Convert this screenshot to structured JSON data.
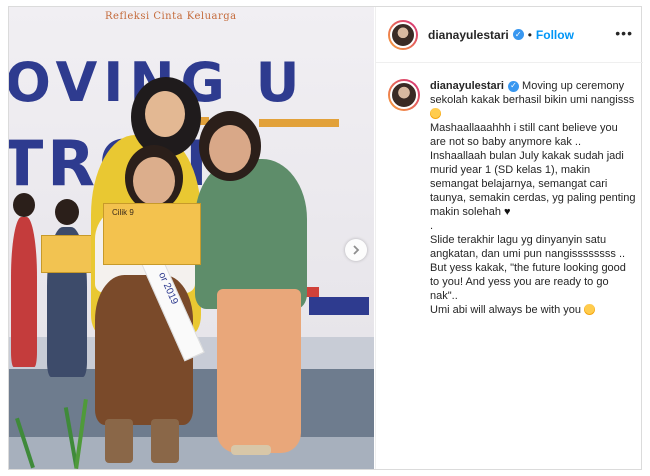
{
  "photo": {
    "banner_script": "Refleksi Cinta Keluarga",
    "banner_line1": "OVING U",
    "banner_line2": "TRON",
    "envelope_text": "Cilik 9",
    "sash_text": "or 2019",
    "next_icon": "chevron-right-icon"
  },
  "header": {
    "username": "dianayulestari",
    "separator": "•",
    "follow_label": "Follow",
    "more_label": "•••"
  },
  "post": {
    "username": "dianayulestari",
    "caption_p1": "Moving up ceremony sekolah kakak berhasil bikin umi nangisss",
    "caption_p2": "Mashaallaaahhh i still cant believe you are not so baby anymore kak .. Inshaallaah bulan July kakak sudah jadi murid year 1 (SD kelas 1), makin semangat belajarnya, semangat cari taunya, semakin cerdas, yg paling penting makin solehah",
    "caption_p3": ".",
    "caption_p4": "Slide terakhir lagu yg dinyanyin satu angkatan, dan umi pun nangissssssss .. But yess kakak, \"the future looking good to you! And yess you are ready to go nak\"..",
    "caption_p5": "Umi abi will always be with you"
  },
  "colors": {
    "follow": "#0095f6",
    "verified": "#3897f0",
    "banner_text": "#2e3b8f"
  }
}
